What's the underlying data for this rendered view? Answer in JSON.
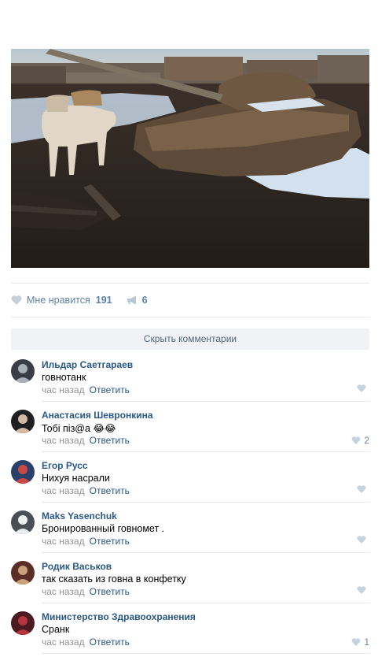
{
  "post": {
    "photo_icon": "photo-tank-in-yard",
    "likes_label": "Мне нравится",
    "likes_count": "191",
    "shares_count": "6"
  },
  "comments_toggle": "Скрыть комментарии",
  "comments": [
    {
      "author": "Ильдар Саетгараев",
      "text": "говнотанк",
      "time": "час назад",
      "reply": "Ответить",
      "likes": ""
    },
    {
      "author": "Анастасия Шевронкина",
      "text": "Тобі піз@а",
      "emoji": "😂😂",
      "time": "час назад",
      "reply": "Ответить",
      "likes": "2"
    },
    {
      "author": "Егор Русс",
      "text": "Нихуя насрали",
      "time": "час назад",
      "reply": "Ответить",
      "likes": ""
    },
    {
      "author": "Maks Yasenchuk",
      "text": "Бронированный говномет .",
      "time": "час назад",
      "reply": "Ответить",
      "likes": ""
    },
    {
      "author": "Родик Васьков",
      "text": "так сказать из говна в конфетку",
      "time": "час назад",
      "reply": "Ответить",
      "likes": ""
    },
    {
      "author": "Министерство Здравоохранения",
      "text": "Сранк",
      "time": "час назад",
      "reply": "Ответить",
      "likes": "1"
    }
  ],
  "colors": {
    "link": "#2a5885",
    "muted": "#939393",
    "like": "#5e81a8",
    "toggle_bg": "#f0f2f5"
  }
}
